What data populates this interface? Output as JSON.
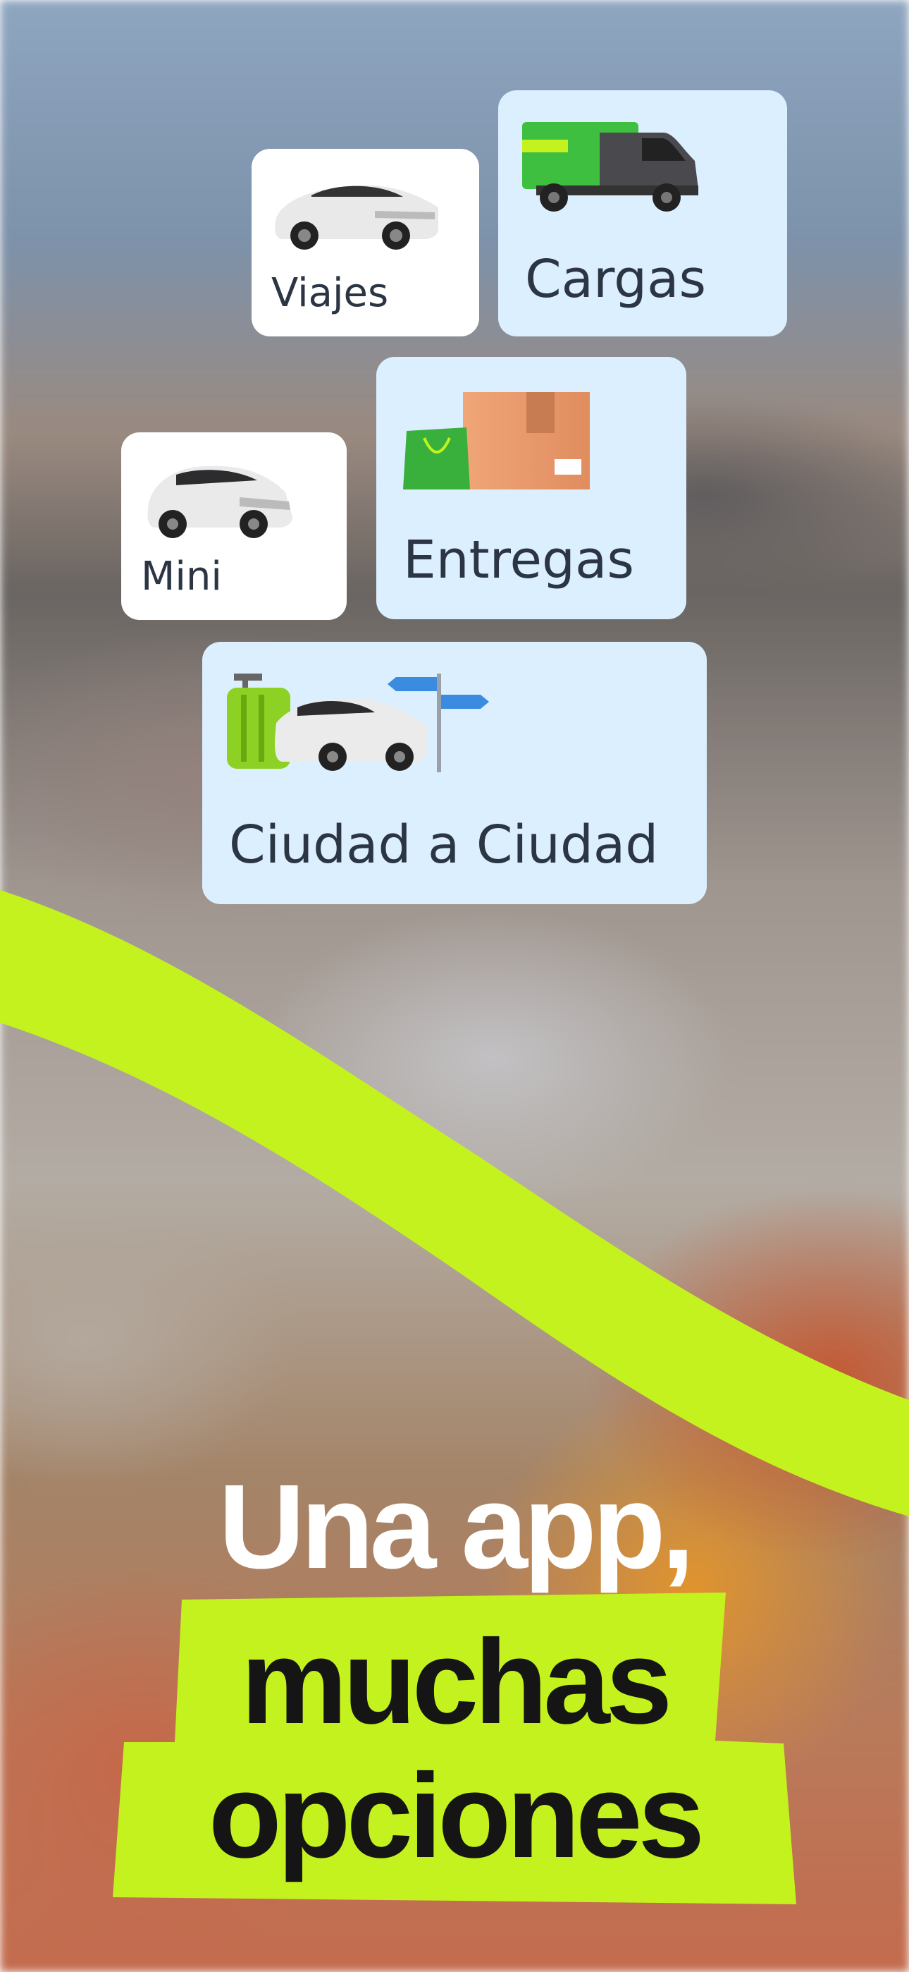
{
  "services": {
    "viajes": {
      "label": "Viajes",
      "icon": "car-icon"
    },
    "cargas": {
      "label": "Cargas",
      "icon": "truck-icon"
    },
    "mini": {
      "label": "Mini",
      "icon": "compact-car-icon"
    },
    "entregas": {
      "label": "Entregas",
      "icon": "package-icon"
    },
    "ciudad": {
      "label": "Ciudad a Ciudad",
      "icon": "luggage-car-signpost-icon"
    }
  },
  "headline": {
    "line1": "Una app,",
    "line2": "muchas",
    "line3": "opciones"
  },
  "colors": {
    "accent": "#c4f21e",
    "card_blue": "#dcefff",
    "card_white": "#ffffff",
    "text_dark": "#2b3543"
  }
}
